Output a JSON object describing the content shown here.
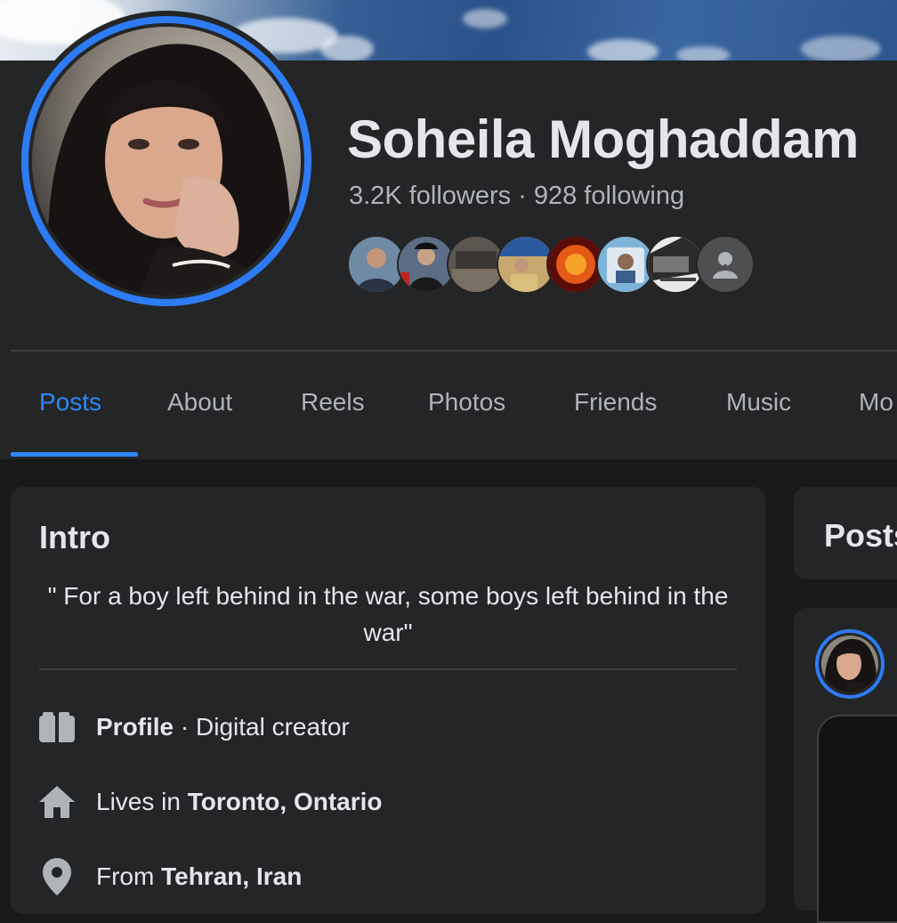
{
  "profile": {
    "name": "Soheila Moghaddam",
    "followers": "3.2K followers",
    "separator": "·",
    "following": "928 following",
    "mutual_friend_avatars": [
      {
        "icon": "friend-avatar-icon",
        "color": "#6f8aa3"
      },
      {
        "icon": "friend-avatar-icon",
        "color": "#5e6d86"
      },
      {
        "icon": "friend-avatar-icon",
        "color": "#5b5650"
      },
      {
        "icon": "friend-avatar-icon",
        "color": "#b58b4c"
      },
      {
        "icon": "friend-avatar-icon",
        "color": "#d2461a"
      },
      {
        "icon": "friend-avatar-icon",
        "color": "#7fb3d8"
      },
      {
        "icon": "friend-avatar-icon",
        "color": "#9a9a9a"
      }
    ],
    "more_friends_icon": "more-dots-icon"
  },
  "tabs": [
    {
      "label": "Posts",
      "active": true
    },
    {
      "label": "About",
      "active": false
    },
    {
      "label": "Reels",
      "active": false
    },
    {
      "label": "Photos",
      "active": false
    },
    {
      "label": "Friends",
      "active": false
    },
    {
      "label": "Music",
      "active": false
    },
    {
      "label": "Mo",
      "active": false
    }
  ],
  "intro": {
    "title": "Intro",
    "bio": "\" For a boy left behind in the war, some boys left behind in the war\"",
    "items": [
      {
        "icon": "briefcase-icon",
        "bold": "Profile",
        "rest": " · Digital creator"
      },
      {
        "icon": "home-icon",
        "prefix": "Lives in ",
        "bold": "Toronto, Ontario"
      },
      {
        "icon": "location-pin-icon",
        "prefix": "From ",
        "bold": "Tehran, Iran"
      }
    ]
  },
  "posts": {
    "title": "Posts"
  },
  "colors": {
    "accent": "#2d88ff",
    "card_bg": "#242526",
    "page_bg": "#18191a",
    "text_primary": "#e4e6eb",
    "text_secondary": "#b0b3b8"
  }
}
